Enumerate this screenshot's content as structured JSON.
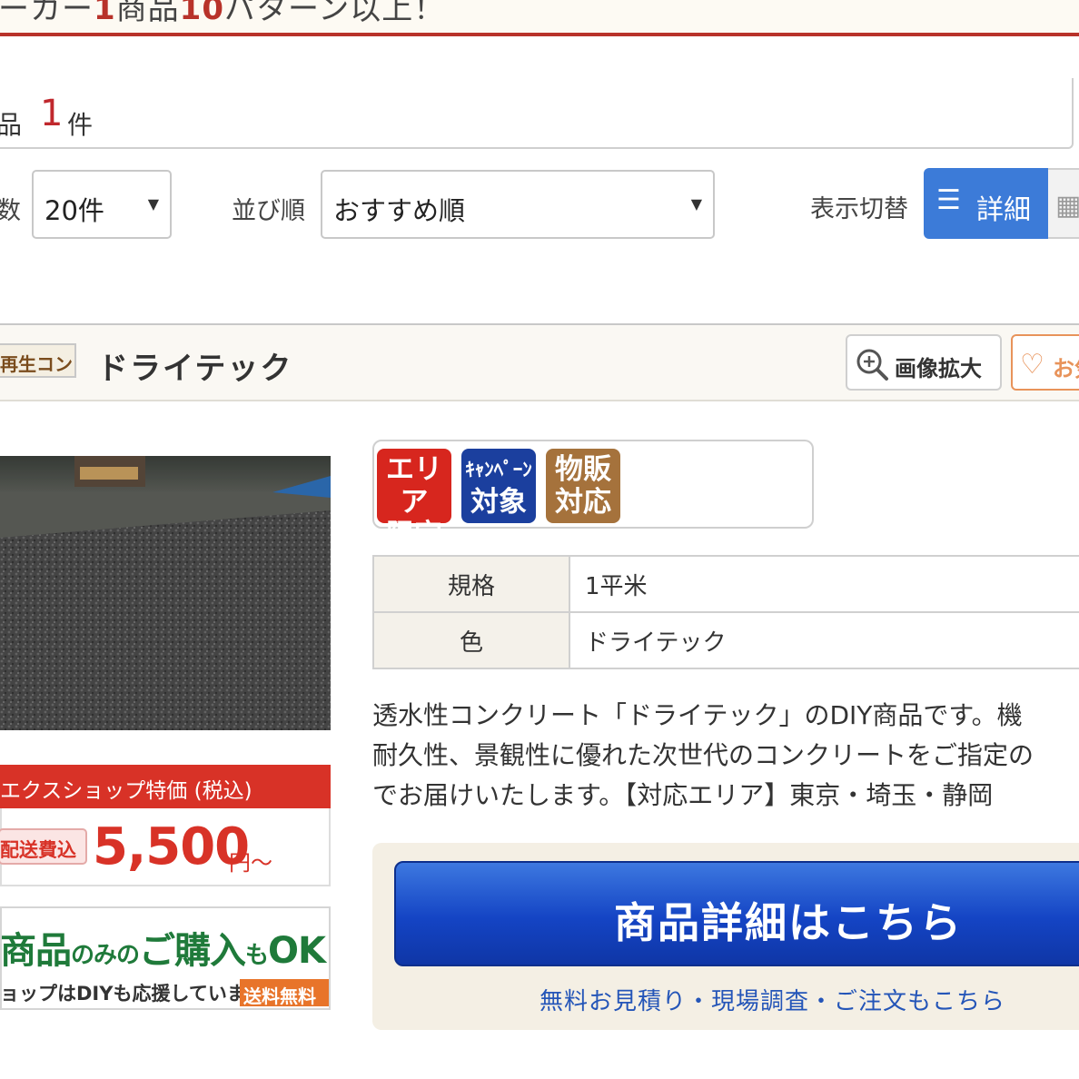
{
  "banner": {
    "pre": "ーカー",
    "num1": "1",
    "mid": "商品",
    "num2": "10",
    "post": "パターン以上！"
  },
  "results": {
    "label": "品",
    "count": "1",
    "unit": "件"
  },
  "controls": {
    "per_page_label": "数",
    "per_page_value": "20件",
    "sort_label": "並び順",
    "sort_value": "おすすめ順",
    "view_label": "表示切替",
    "view_detail": "詳細"
  },
  "product": {
    "category_badge": "再生コン",
    "title": "ドライテック",
    "zoom_label": "画像拡大",
    "fav_label": "お気",
    "badges": [
      {
        "line1": "エリア",
        "line2": "限定",
        "color": "#d7261e"
      },
      {
        "line1": "ｷｬﾝﾍﾟｰﾝ",
        "line2": "対象",
        "color": "#1b3f9e"
      },
      {
        "line1": "物販",
        "line2": "対応",
        "color": "#a5723c"
      }
    ],
    "specs": [
      {
        "key": "規格",
        "value": "1平米"
      },
      {
        "key": "色",
        "value": "ドライテック"
      }
    ],
    "description": [
      "透水性コンクリート「ドライテック」のDIY商品です。機",
      "耐久性、景観性に優れた次世代のコンクリートをご指定の",
      "でお届けいたします。【対応エリア】東京・埼玉・静岡"
    ],
    "price_header": "エクスショップ特価 (税込)",
    "shipping_badge": "配送費込",
    "price": "5,500",
    "price_unit": "円〜",
    "diy_banner": {
      "part1": "商品",
      "part2": "のみの",
      "part3": "ご購入",
      "part4": "も",
      "part5": "OK!!",
      "sub": "ョップはDIYも応援しています！",
      "free": "送料無料"
    },
    "cta_label": "商品詳細はこちら",
    "cta_link": "無料お見積り・現場調査・ご注文もこちら"
  }
}
